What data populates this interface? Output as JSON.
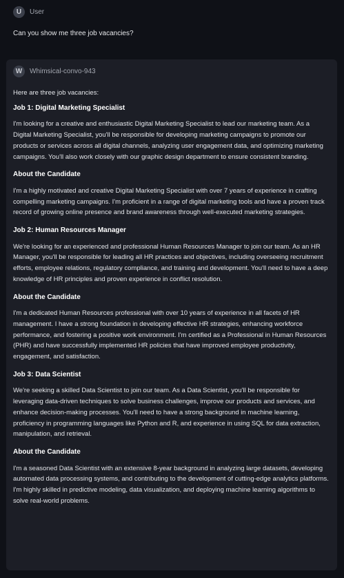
{
  "user_message": {
    "avatar_letter": "U",
    "author": "User",
    "text": "Can you show me three job vacancies?"
  },
  "assistant_message": {
    "avatar_letter": "W",
    "author": "Whimsical-convo-943",
    "intro": "Here are three job vacancies:",
    "sections": [
      {
        "heading": "Job 1: Digital Marketing Specialist",
        "body": "I'm looking for a creative and enthusiastic Digital Marketing Specialist to lead our marketing team. As a Digital Marketing Specialist, you'll be responsible for developing marketing campaigns to promote our products or services across all digital channels, analyzing user engagement data, and optimizing marketing campaigns. You'll also work closely with our graphic design department to ensure consistent branding."
      },
      {
        "heading": "About the Candidate",
        "body": "I'm a highly motivated and creative Digital Marketing Specialist with over 7 years of experience in crafting compelling marketing campaigns. I'm proficient in a range of digital marketing tools and have a proven track record of growing online presence and brand awareness through well-executed marketing strategies."
      },
      {
        "heading": "Job 2: Human Resources Manager",
        "body": "We're looking for an experienced and professional Human Resources Manager to join our team. As an HR Manager, you'll be responsible for leading all HR practices and objectives, including overseeing recruitment efforts, employee relations, regulatory compliance, and training and development. You'll need to have a deep knowledge of HR principles and proven experience in conflict resolution."
      },
      {
        "heading": "About the Candidate",
        "body": "I'm a dedicated Human Resources professional with over 10 years of experience in all facets of HR management. I have a strong foundation in developing effective HR strategies, enhancing workforce performance, and fostering a positive work environment. I'm certified as a Professional in Human Resources (PHR) and have successfully implemented HR policies that have improved employee productivity, engagement, and satisfaction."
      },
      {
        "heading": "Job 3: Data Scientist",
        "body": "We're seeking a skilled Data Scientist to join our team. As a Data Scientist, you'll be responsible for leveraging data-driven techniques to solve business challenges, improve our products and services, and enhance decision-making processes. You'll need to have a strong background in machine learning, proficiency in programming languages like Python and R, and experience in using SQL for data extraction, manipulation, and retrieval."
      },
      {
        "heading": "About the Candidate",
        "body": "I'm a seasoned Data Scientist with an extensive 8-year background in analyzing large datasets, developing automated data processing systems, and contributing to the development of cutting-edge analytics platforms. I'm highly skilled in predictive modeling, data visualization, and deploying machine learning algorithms to solve real-world problems."
      }
    ]
  }
}
